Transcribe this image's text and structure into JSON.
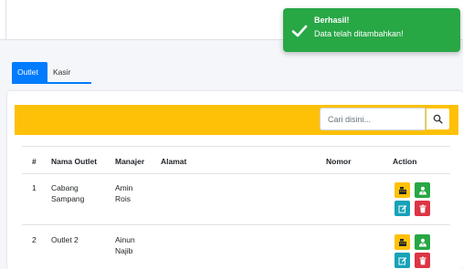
{
  "toast": {
    "title": "Berhasil!",
    "message": "Data telah ditambahkan!",
    "color": "#28a745",
    "icon": "check-icon"
  },
  "tabs": [
    {
      "label": "Outlet",
      "active": true
    },
    {
      "label": "Kasir",
      "active": false
    }
  ],
  "search": {
    "placeholder": "Cari disini...",
    "icon": "search-icon",
    "bar_color": "#ffc107"
  },
  "table": {
    "headers": [
      "#",
      "Nama Outlet",
      "Manajer",
      "Alamat",
      "Nomor",
      "Action"
    ],
    "rows": [
      {
        "no": "1",
        "nama_outlet": "Cabang Sampang",
        "manajer": "Amin Rois",
        "alamat": "",
        "nomor": ""
      },
      {
        "no": "2",
        "nama_outlet": "Outlet 2",
        "manajer": "Ainun Najib",
        "alamat": "",
        "nomor": ""
      }
    ],
    "actions": [
      {
        "icon": "cash-register-icon",
        "color": "#ffc107"
      },
      {
        "icon": "user-tie-icon",
        "color": "#28a745"
      },
      {
        "icon": "edit-icon",
        "color": "#17a2b8"
      },
      {
        "icon": "trash-icon",
        "color": "#dc3545"
      }
    ]
  }
}
